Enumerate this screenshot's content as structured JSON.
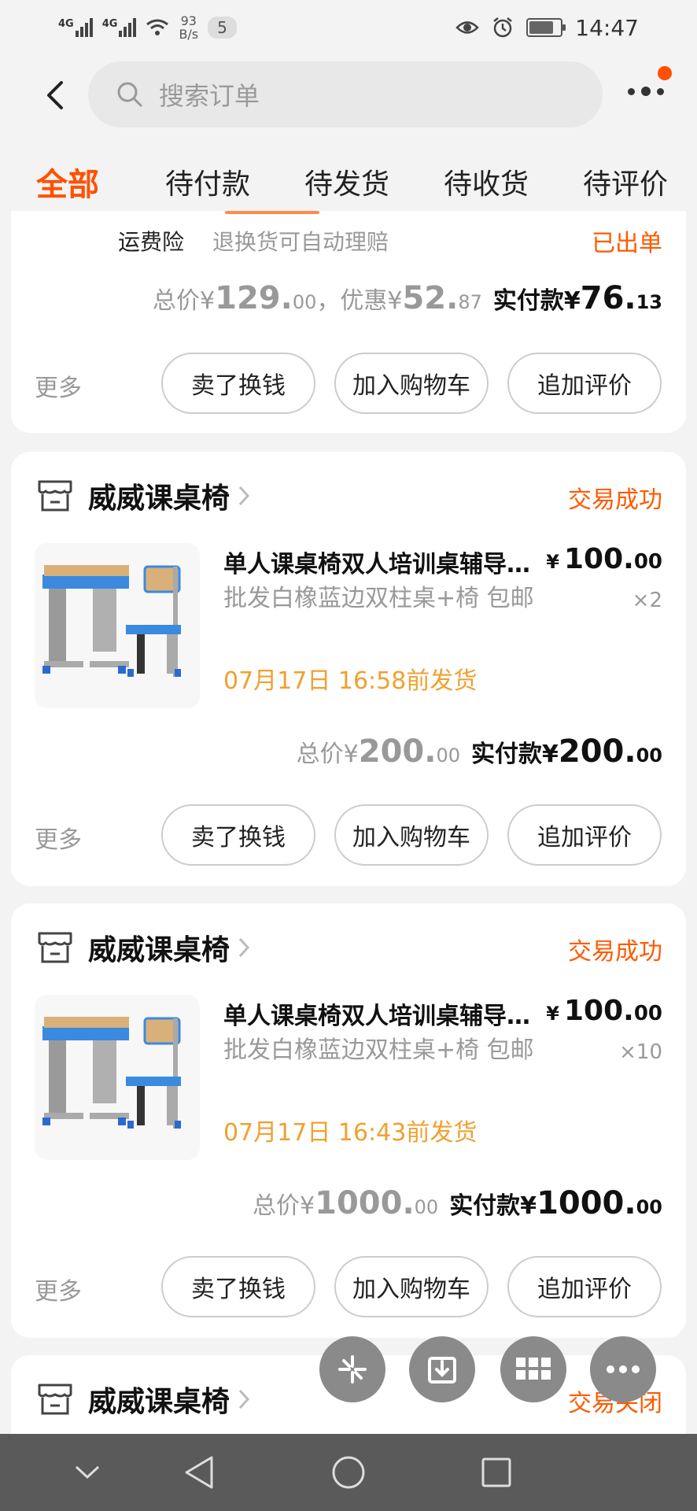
{
  "status_bar": {
    "net1": "4G",
    "net2": "4G",
    "speed_value": "93",
    "speed_unit": "B/s",
    "notif_count": "5",
    "time": "14:47"
  },
  "header": {
    "search_placeholder": "搜索订单"
  },
  "tabs": [
    {
      "label": "全部",
      "active": true
    },
    {
      "label": "待付款"
    },
    {
      "label": "待发货"
    },
    {
      "label": "待收货"
    },
    {
      "label": "待评价"
    }
  ],
  "partial_order": {
    "insurance_label": "运费险",
    "insurance_desc": "退换货可自动理赔",
    "insurance_status": "已出单",
    "total_label": "总价¥",
    "total_int": "129.",
    "total_dec": "00",
    "discount_label": "，优惠¥",
    "discount_int": "52.",
    "discount_dec": "87",
    "paid_label": "实付款¥",
    "paid_int": "76.",
    "paid_dec": "13"
  },
  "orders": [
    {
      "shop": "威威课桌椅",
      "status": "交易成功",
      "title": "单人课桌椅双人培训桌辅导班学生课桌椅",
      "sku": "批发白橡蓝边双柱桌+椅 包邮",
      "ship": "07月17日 16:58前发货",
      "price_int": "100.",
      "price_dec": "00",
      "qty": "×2",
      "total_label": "总价¥",
      "total_int": "200.",
      "total_dec": "00",
      "paid_label": "实付款¥",
      "paid_int": "200.",
      "paid_dec": "00"
    },
    {
      "shop": "威威课桌椅",
      "status": "交易成功",
      "title": "单人课桌椅双人培训桌辅导班学生课桌椅",
      "sku": "批发白橡蓝边双柱桌+椅 包邮",
      "ship": "07月17日 16:43前发货",
      "price_int": "100.",
      "price_dec": "00",
      "qty": "×10",
      "total_label": "总价¥",
      "total_int": "1000.",
      "total_dec": "00",
      "paid_label": "实付款¥",
      "paid_int": "1000.",
      "paid_dec": "00"
    },
    {
      "shop": "威威课桌椅",
      "status": "交易关闭"
    }
  ],
  "currency": "¥",
  "actions": {
    "more": "更多",
    "sell": "卖了换钱",
    "add_cart": "加入购物车",
    "review": "追加评价"
  },
  "colors": {
    "accent": "#ff5000",
    "ship_text": "#f0a030",
    "chair_blue": "#2a7ad8"
  }
}
